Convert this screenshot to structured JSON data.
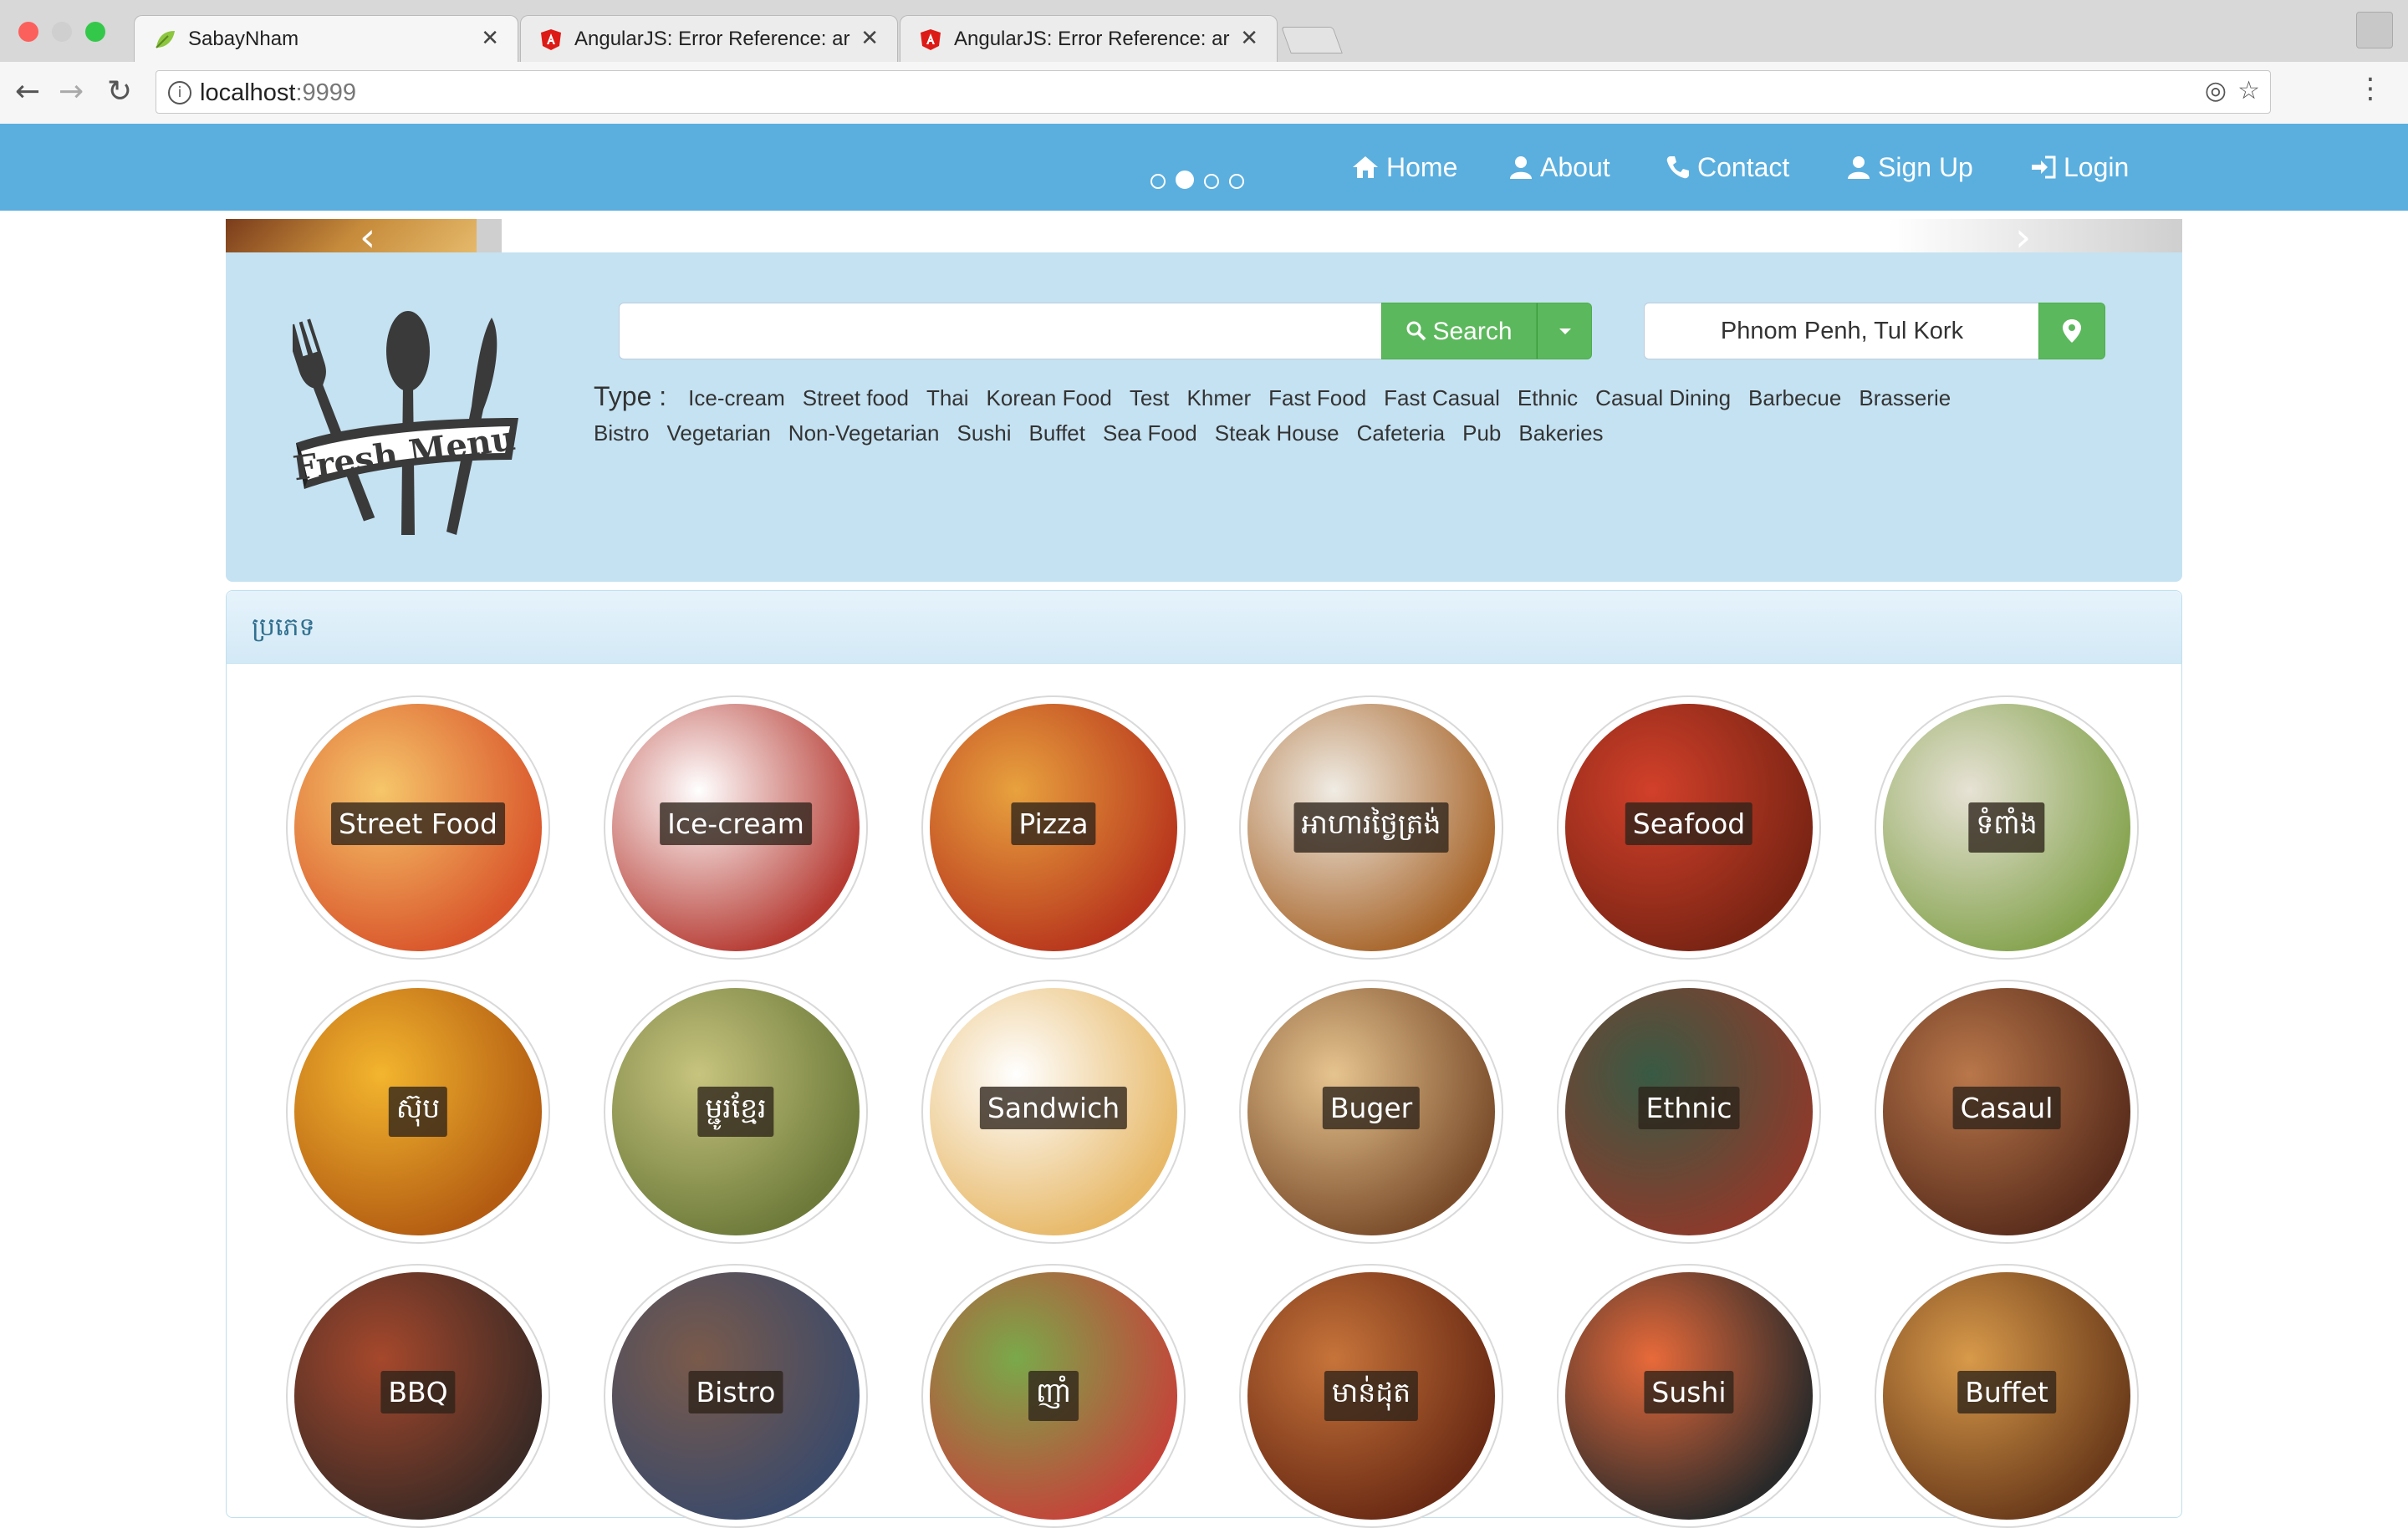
{
  "browser": {
    "tabs": [
      {
        "title": "SabayNham",
        "active": true,
        "icon": "leaf-icon"
      },
      {
        "title": "AngularJS: Error Reference: ar",
        "active": false,
        "icon": "angular-icon"
      },
      {
        "title": "AngularJS: Error Reference: ar",
        "active": false,
        "icon": "angular-icon"
      }
    ],
    "url_host": "localhost",
    "url_port": ":9999",
    "close_glyph": "✕"
  },
  "nav": {
    "items": [
      {
        "label": "Home",
        "icon": "home-icon"
      },
      {
        "label": "About",
        "icon": "user-icon"
      },
      {
        "label": "Contact",
        "icon": "phone-icon"
      },
      {
        "label": "Sign Up",
        "icon": "user-icon"
      },
      {
        "label": "Login",
        "icon": "login-icon"
      }
    ],
    "carousel_active_index": 1,
    "carousel_count": 4
  },
  "logo": {
    "text": "Fresh Menu"
  },
  "search": {
    "query_value": "",
    "button_label": "Search",
    "location_value": "Phnom Penh, Tul Kork"
  },
  "types": {
    "label": "Type :",
    "row1": [
      "Ice-cream",
      "Street food",
      "Thai",
      "Korean Food",
      "Test",
      "Khmer",
      "Fast Food",
      "Fast Casual",
      "Ethnic",
      "Casual Dining",
      "Barbecue",
      "Brasserie"
    ],
    "row2": [
      "Bistro",
      "Vegetarian",
      "Non-Vegetarian",
      "Sushi",
      "Buffet",
      "Sea Food",
      "Steak House",
      "Cafeteria",
      "Pub",
      "Bakeries"
    ]
  },
  "categories": {
    "title": "ប្រភេទ",
    "items": [
      {
        "label": "Street Food",
        "colors": [
          "#f6c66a",
          "#d9552b"
        ]
      },
      {
        "label": "Ice-cream",
        "colors": [
          "#ffffff",
          "#b63b33"
        ]
      },
      {
        "label": "Pizza",
        "colors": [
          "#e8a23e",
          "#b8361d"
        ]
      },
      {
        "label": "អាហារថ្ងៃត្រង់",
        "colors": [
          "#f0ece4",
          "#a8662c"
        ]
      },
      {
        "label": "Seafood",
        "colors": [
          "#d2402a",
          "#7a2414"
        ]
      },
      {
        "label": "ទំពាំង",
        "colors": [
          "#e7e2d5",
          "#86a450"
        ]
      },
      {
        "label": "ស៊ុប",
        "colors": [
          "#f3b52e",
          "#b35c12"
        ]
      },
      {
        "label": "ម្ជូរខ្មែរ",
        "colors": [
          "#c7c47e",
          "#6d7a3a"
        ]
      },
      {
        "label": "Sandwich",
        "colors": [
          "#ffffff",
          "#e7b867"
        ]
      },
      {
        "label": "Buger",
        "colors": [
          "#e6c48f",
          "#7b4d2b"
        ]
      },
      {
        "label": "Ethnic",
        "colors": [
          "#385a44",
          "#8d3a2b"
        ]
      },
      {
        "label": "Casaul",
        "colors": [
          "#b9774a",
          "#5a2d1c"
        ]
      },
      {
        "label": "BBQ",
        "colors": [
          "#a6482c",
          "#3b2a25"
        ]
      },
      {
        "label": "Bistro",
        "colors": [
          "#7a5a4a",
          "#3b4a6a"
        ]
      },
      {
        "label": "ញាំ",
        "colors": [
          "#7aa94a",
          "#c4443a"
        ]
      },
      {
        "label": "មាន់ដុត",
        "colors": [
          "#c7743a",
          "#6a2a14"
        ]
      },
      {
        "label": "Sushi",
        "colors": [
          "#e86a3a",
          "#2a2a2a"
        ]
      },
      {
        "label": "Buffet",
        "colors": [
          "#d89a4a",
          "#6a3a1a"
        ]
      }
    ]
  }
}
